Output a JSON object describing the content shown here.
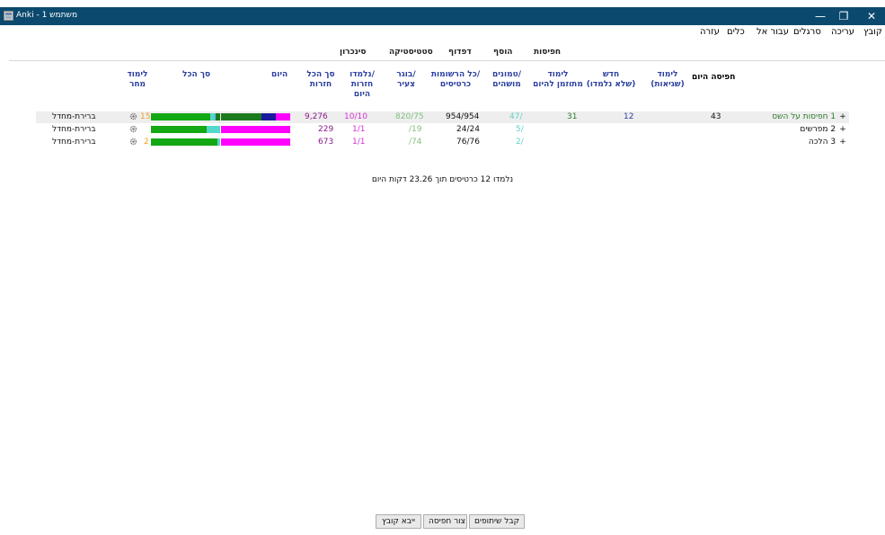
{
  "window": {
    "title": "משתמש 1 - Anki",
    "minimize_glyph": "—",
    "maximize_glyph": "❐",
    "close_glyph": "✕"
  },
  "menu": {
    "file": "קובץ",
    "edit": "עריכה",
    "view": "סרגלים",
    "go": "עבור אל",
    "tools": "כלים",
    "help": "עזרה"
  },
  "toolbar": {
    "decks": "חפיסות",
    "add": "הוסף",
    "browse": "דפדוף",
    "stats": "סטטיסטיקה",
    "sync": "סינכרון"
  },
  "headers": {
    "deck_today": "חפיסה היום",
    "learn": "לימוד",
    "learn_sub": "(שגיאות)",
    "new": "חדש",
    "new_sub": "(שלא נלמדו)",
    "due": "לימוד",
    "due_sub": "מתוזמן להיום",
    "suspended": "טמונים/",
    "suspended_sub": "מושהים",
    "total_notes": "כל הרשומות/",
    "total_notes_sub": "כרטיסים",
    "mature": "בוגר/",
    "mature_sub": "צעיר",
    "reviewed": "נלמדו/",
    "reviewed_sub": "חזרות",
    "reviewed_sub2": "היום",
    "total_reviews": "סך הכל",
    "total_reviews_sub": "חזרות",
    "today": "היום",
    "all": "סך הכל",
    "tomorrow": "לימוד",
    "tomorrow_sub": "מחר"
  },
  "decks": [
    {
      "expand": "+",
      "name": "1 חפיסות על השס",
      "today": "43",
      "new": "12",
      "due": "31",
      "suspended": "47/",
      "notes_cards": "954/954",
      "mature_young": "820/75",
      "reviewed": "10/10",
      "total_reviews": "9,276",
      "tomorrow": "15",
      "option": "ברירת-מחדל",
      "today_bar": [
        0.2,
        0.3,
        0.5
      ],
      "all_bar": [
        0.15,
        0.05,
        0.02,
        0.1,
        0.68
      ]
    },
    {
      "expand": "+",
      "name": "2 מפרשים",
      "today": "",
      "new": "",
      "due": "",
      "suspended": "5/",
      "notes_cards": "24/24",
      "mature_young": "/19",
      "reviewed": "1/1",
      "total_reviews": "229",
      "tomorrow": "",
      "option": "ברירת-מחדל",
      "today_bar": [
        1.0
      ],
      "all_bar": [
        0.2,
        0.8
      ]
    },
    {
      "expand": "+",
      "name": "3 הלכה",
      "today": "",
      "new": "",
      "due": "",
      "suspended": "2/",
      "notes_cards": "76/76",
      "mature_young": "/74",
      "reviewed": "1/1",
      "total_reviews": "673",
      "tomorrow": "2",
      "option": "ברירת-מחדל",
      "today_bar": [
        1.0
      ],
      "all_bar": [
        0.05,
        0.95
      ]
    }
  ],
  "summary": "נלמדו 12 כרטיסים תוך 23.26 דקות היום",
  "buttons": {
    "shared": "קבל שיתופים",
    "create": "צור חפיסה",
    "import": "ייבא קובץ"
  },
  "colors": {
    "titlebar": "#0b4a6e",
    "bar_today_blue": "#1a1aa0",
    "bar_today_darkgreen": "#1b7a1b",
    "bar_magenta": "#ff00ff",
    "bar_green": "#14a814",
    "bar_teal": "#53d8cc",
    "bar_lightblue": "#5bc0de"
  }
}
